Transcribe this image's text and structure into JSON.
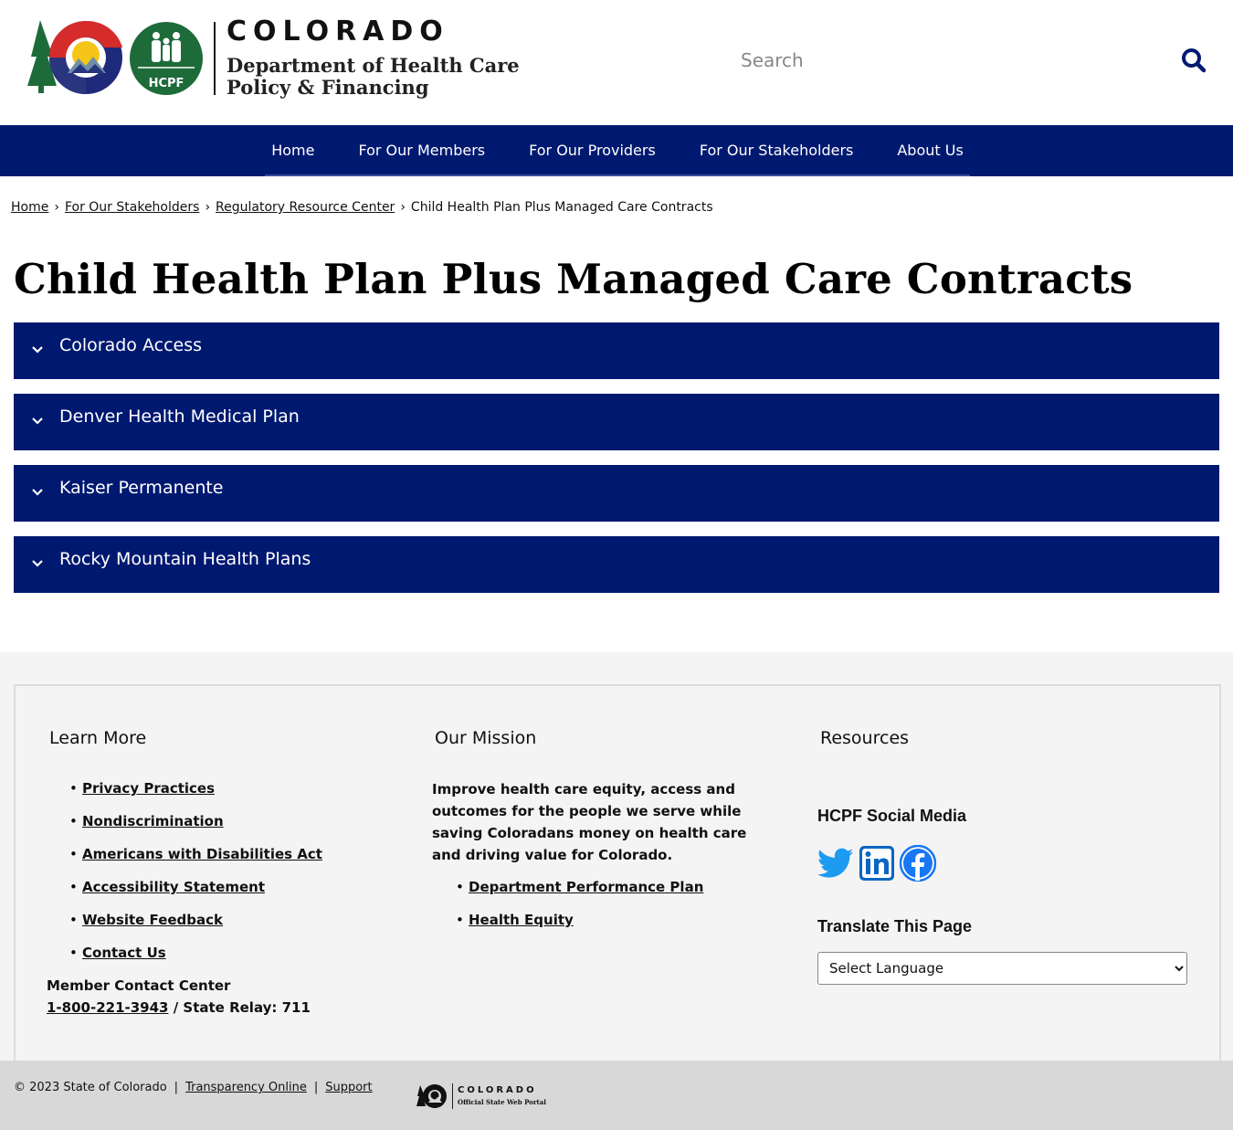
{
  "header": {
    "brand_state": "COLORADO",
    "brand_dept_line1": "Department of Health Care",
    "brand_dept_line2": "Policy & Financing",
    "hcpf_badge": "HCPF",
    "search_placeholder": "Search"
  },
  "nav": {
    "items": [
      {
        "label": "Home"
      },
      {
        "label": "For Our Members"
      },
      {
        "label": "For Our Providers"
      },
      {
        "label": "For Our Stakeholders"
      },
      {
        "label": "About Us"
      }
    ]
  },
  "breadcrumb": {
    "items": [
      "Home",
      "For Our Stakeholders",
      "Regulatory Resource Center"
    ],
    "current": "Child Health Plan Plus Managed Care Contracts"
  },
  "page_title": "Child Health Plan Plus Managed Care Contracts",
  "accordion": {
    "items": [
      {
        "label": "Colorado Access"
      },
      {
        "label": "Denver Health Medical Plan"
      },
      {
        "label": "Kaiser Permanente"
      },
      {
        "label": "Rocky Mountain Health Plans"
      }
    ]
  },
  "footer": {
    "learn_more": {
      "heading": "Learn More",
      "links": [
        "Privacy Practices",
        "Nondiscrimination",
        "Americans with Disabilities Act",
        "Accessibility Statement",
        "Website Feedback",
        "Contact Us"
      ],
      "contact_label": "Member Contact Center",
      "phone": "1-800-221-3943",
      "relay": "/ State Relay: 711"
    },
    "mission": {
      "heading": "Our Mission",
      "text": "Improve health care equity, access and outcomes for the people we serve while saving Coloradans money on health care and driving value for Colorado.",
      "links": [
        "Department Performance Plan",
        "Health Equity"
      ]
    },
    "resources": {
      "heading": "Resources",
      "social_heading": "HCPF Social Media",
      "social_icons": [
        "twitter-icon",
        "linkedin-icon",
        "facebook-icon"
      ],
      "translate_heading": "Translate This Page",
      "language_select": "Select Language"
    }
  },
  "bottom": {
    "copyright": "© 2023 State of Colorado",
    "links": [
      "Transparency Online",
      "Support"
    ],
    "portal_state": "COLORADO",
    "portal_sub": "Official State Web Portal"
  },
  "colors": {
    "nav_blue": "#001970",
    "footer_bg": "#f4f4f4",
    "bottom_bar": "#d8d8d8",
    "twitter": "#1d9bf0",
    "linkedin": "#0a66c2",
    "facebook": "#1877f2"
  }
}
